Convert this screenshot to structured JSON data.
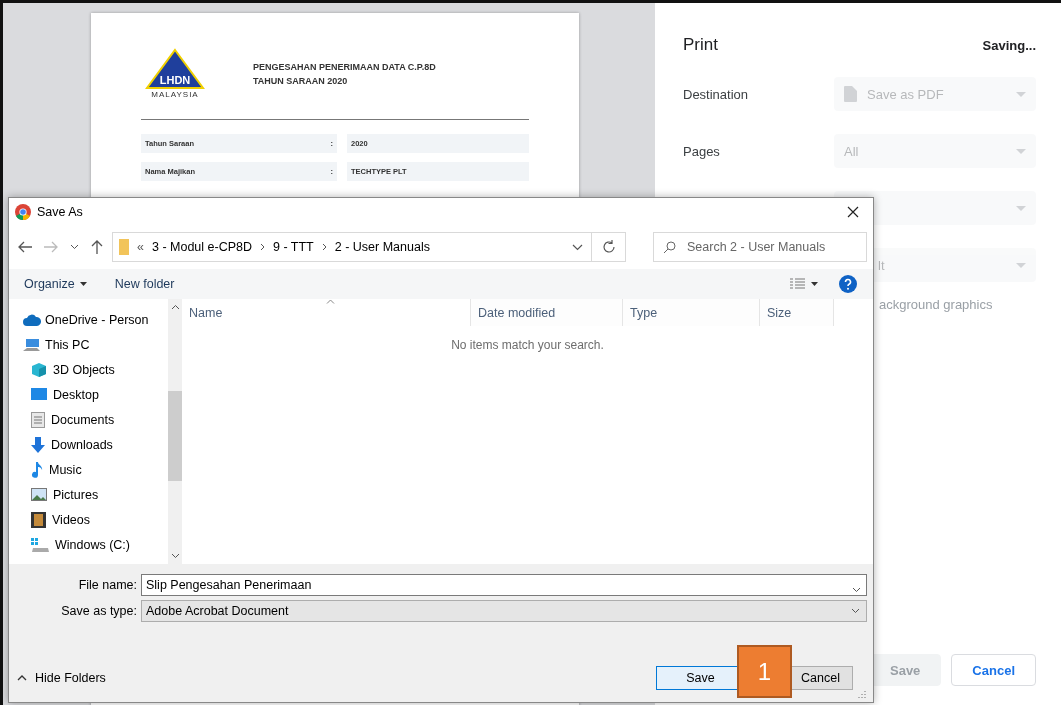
{
  "preview": {
    "logo_text": "LHDN",
    "logo_subtext": "MALAYSIA",
    "title_lines": [
      "PENGESAHAN PENERIMAAN DATA C.P.8D",
      "TAHUN SARAAN 2020"
    ],
    "rows": [
      {
        "label": "Tahun Saraan",
        "separator": ":",
        "value": "2020"
      },
      {
        "label": "Nama Majikan",
        "separator": ":",
        "value": "TECHTYPE PLT"
      }
    ]
  },
  "print_panel": {
    "title": "Print",
    "status": "Saving...",
    "settings": [
      {
        "label": "Destination",
        "value": "Save as PDF",
        "disabled": true
      },
      {
        "label": "Pages",
        "value": "All",
        "disabled": true
      },
      {
        "disabled": true
      },
      {
        "value": "lt",
        "disabled": true
      }
    ],
    "option_label": "ackground graphics",
    "buttons": [
      {
        "label": "Save",
        "disabled": true
      },
      {
        "label": "Cancel",
        "disabled": false
      }
    ]
  },
  "dialog": {
    "title": "Save As",
    "address": {
      "overflow": "«",
      "crumbs": [
        "3 - Modul e-CP8D",
        "9 - TTT",
        "2 - User Manuals"
      ]
    },
    "search": {
      "placeholder": "Search 2 - User Manuals"
    },
    "toolbar": [
      {
        "label": "Organize",
        "kind": "menu"
      },
      {
        "label": "New folder",
        "kind": "button"
      }
    ],
    "columns": [
      {
        "label": "Name",
        "sorted": true
      },
      {
        "label": "Date modified",
        "sorted": false
      },
      {
        "label": "Type",
        "sorted": false
      },
      {
        "label": "Size",
        "sorted": false
      }
    ],
    "empty_message": "No items match your search.",
    "nav": [
      {
        "label": "OneDrive - Person",
        "kind": "cloud"
      },
      {
        "label": "This PC",
        "kind": "pc",
        "children": [
          {
            "label": "3D Objects",
            "kind": "cube"
          },
          {
            "label": "Desktop",
            "kind": "desktop"
          },
          {
            "label": "Documents",
            "kind": "documents"
          },
          {
            "label": "Downloads",
            "kind": "downloads"
          },
          {
            "label": "Music",
            "kind": "music"
          },
          {
            "label": "Pictures",
            "kind": "pictures"
          },
          {
            "label": "Videos",
            "kind": "videos"
          },
          {
            "label": "Windows  (C:)",
            "kind": "drive"
          }
        ]
      }
    ],
    "file_name": {
      "label": "File name:",
      "value": "Slip Pengesahan Penerimaan"
    },
    "save_type": {
      "label": "Save as type:",
      "value": "Adobe Acrobat Document"
    },
    "hide_folders": "Hide Folders",
    "buttons": [
      {
        "label": "Save",
        "selected": true
      },
      {
        "label": "Cancel",
        "selected": false
      }
    ]
  },
  "callout": "1"
}
